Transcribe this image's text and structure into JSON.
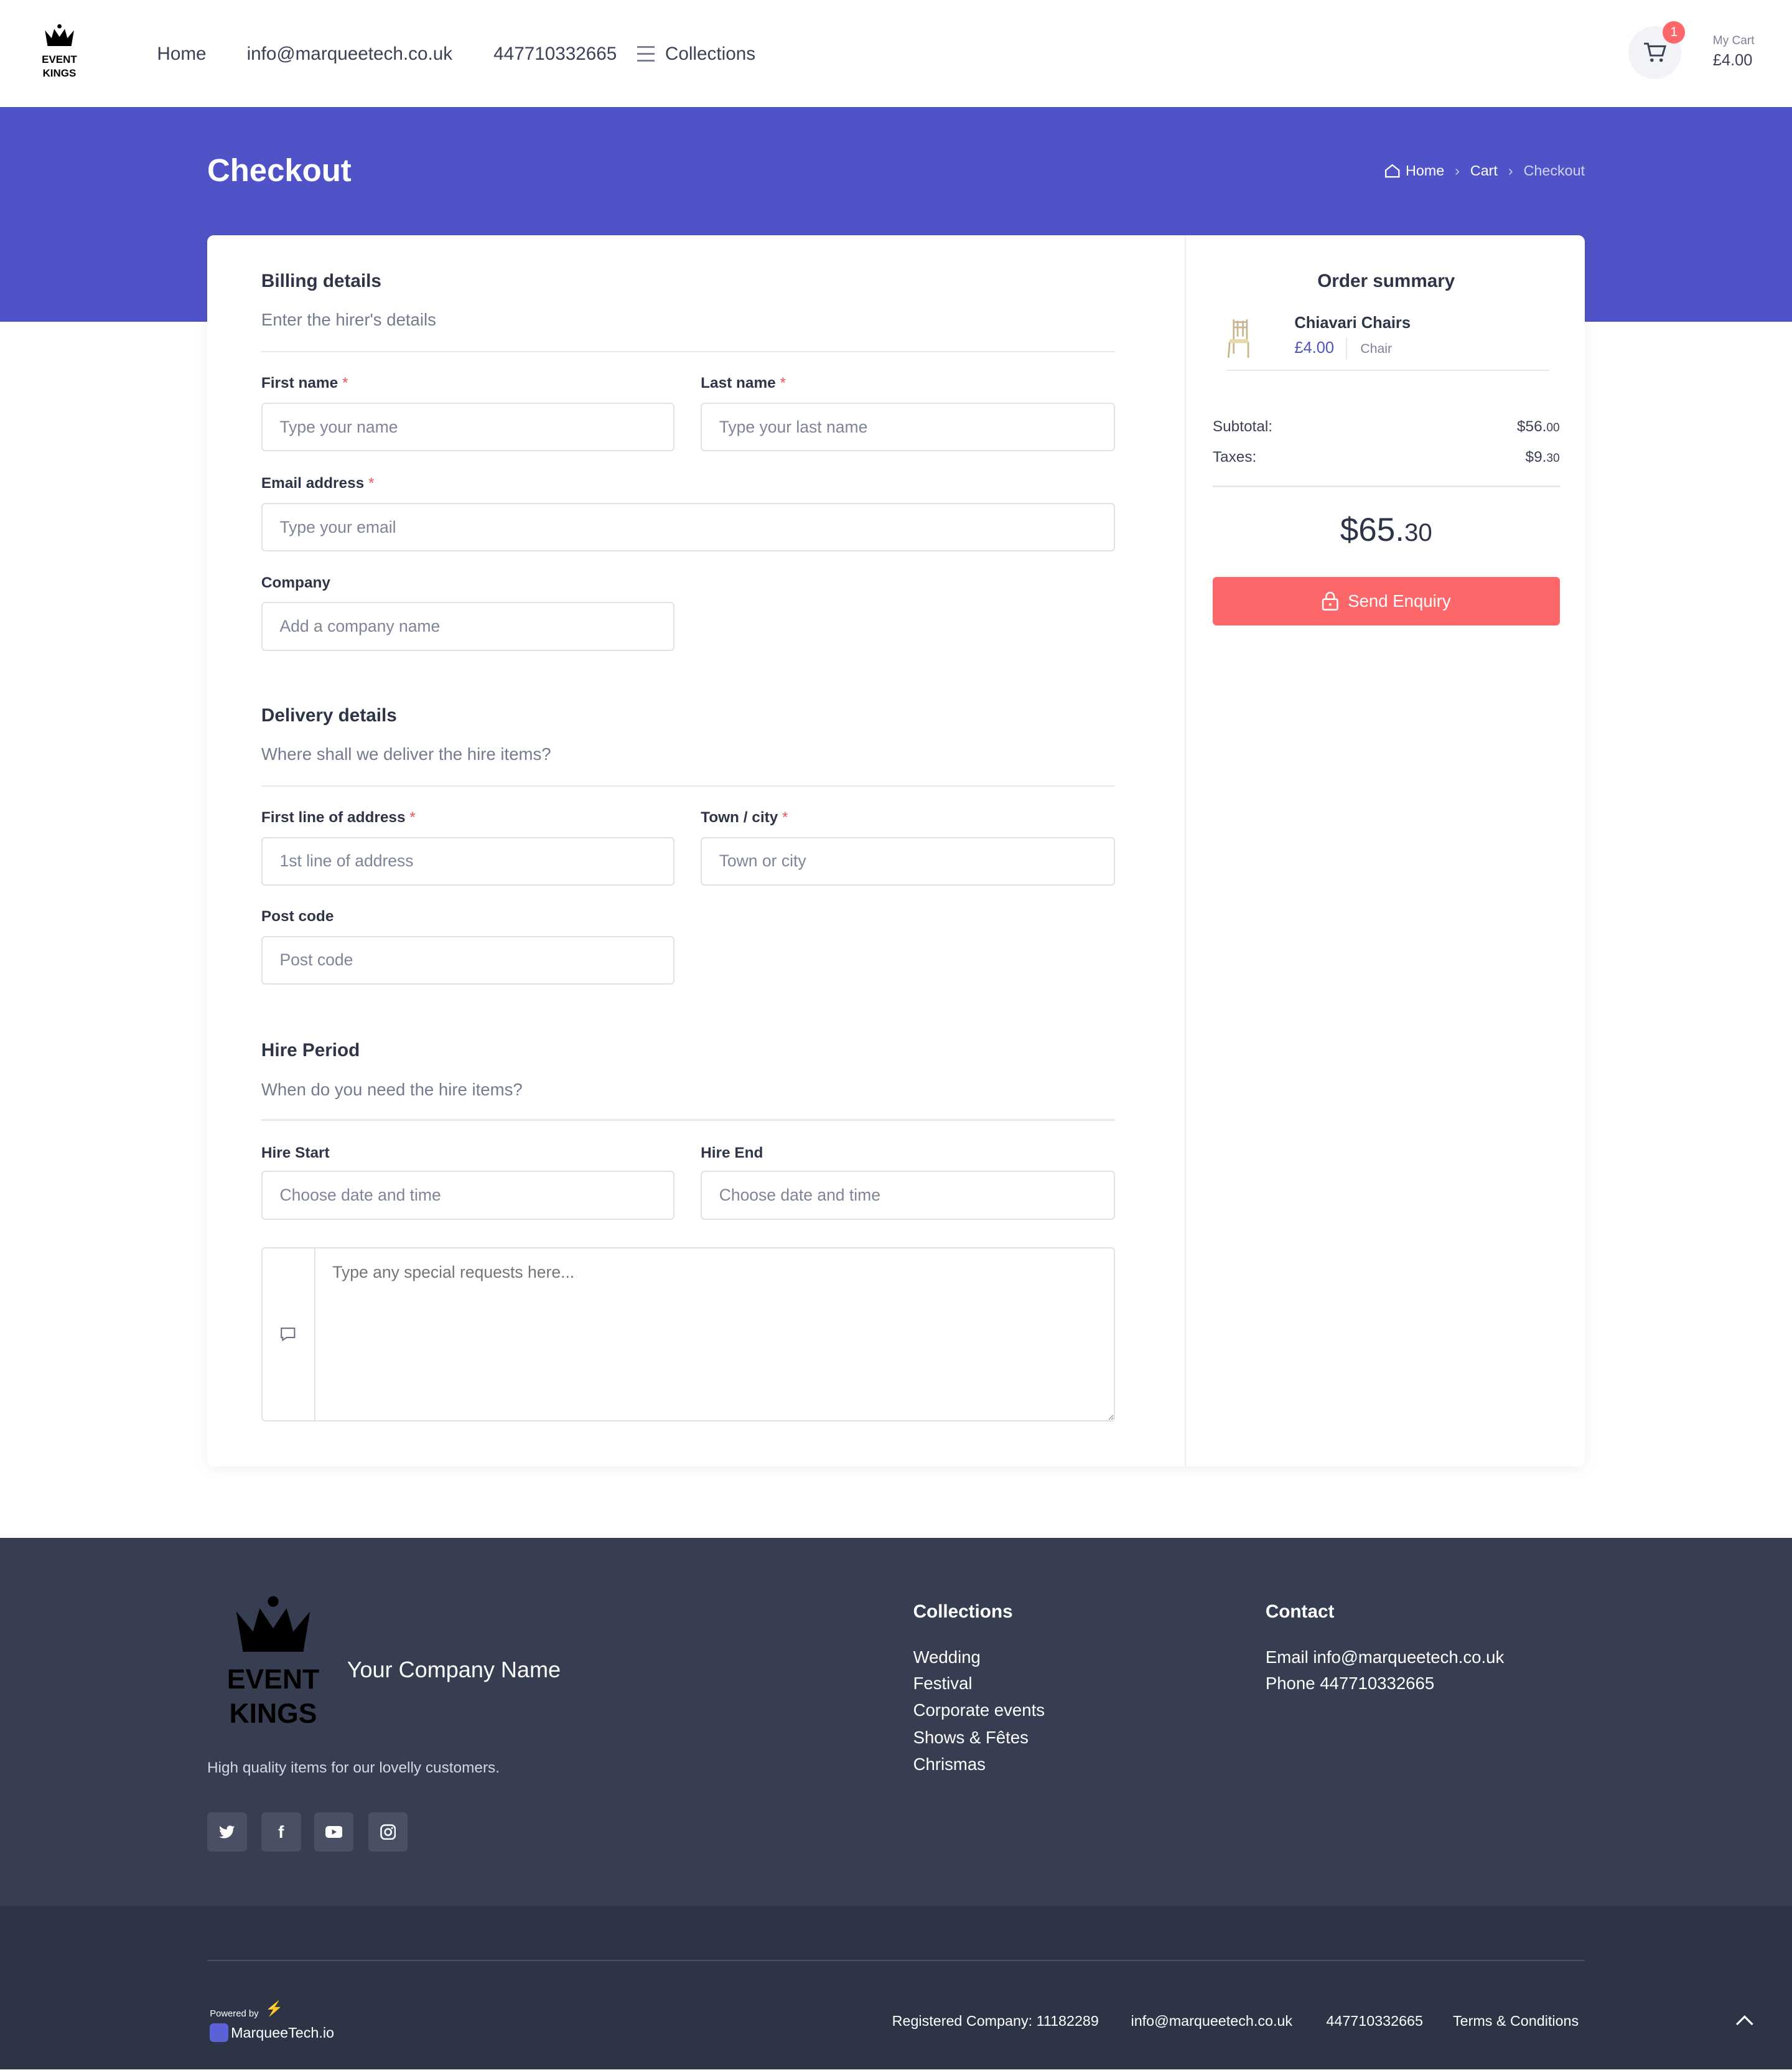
{
  "header": {
    "logo_text": [
      "EVENT",
      "KINGS"
    ],
    "nav": [
      "Home",
      "info@marqueetech.co.uk",
      "447710332665",
      "Collections"
    ],
    "cart_badge": "1",
    "cart_label": "My Cart",
    "cart_total": "£4.00"
  },
  "banner": {
    "title": "Checkout",
    "breadcrumb": [
      "Home",
      "Cart",
      "Checkout"
    ]
  },
  "billing": {
    "title": "Billing details",
    "subtitle": "Enter the hirer's details",
    "first_name": {
      "label": "First name",
      "placeholder": "Type your name"
    },
    "last_name": {
      "label": "Last name",
      "placeholder": "Type your last name"
    },
    "email": {
      "label": "Email address",
      "placeholder": "Type your email"
    },
    "company": {
      "label": "Company",
      "placeholder": "Add a company name"
    }
  },
  "delivery": {
    "title": "Delivery details",
    "subtitle": "Where shall we deliver the hire items?",
    "address": {
      "label": "First line of address",
      "placeholder": "1st line of address"
    },
    "town": {
      "label": "Town / city",
      "placeholder": "Town or city"
    },
    "postcode": {
      "label": "Post code",
      "placeholder": "Post code"
    }
  },
  "hire": {
    "title": "Hire Period",
    "subtitle": "When do you need the hire items?",
    "start": {
      "label": "Hire Start",
      "placeholder": "Choose date and time"
    },
    "end": {
      "label": "Hire End",
      "placeholder": "Choose date and time"
    },
    "requests_placeholder": "Type any special requests here..."
  },
  "required_mark": "*",
  "summary": {
    "title": "Order summary",
    "item": {
      "name": "Chiavari Chairs",
      "price": "£4.00",
      "category": "Chair"
    },
    "subtotal_label": "Subtotal:",
    "subtotal_main": "$56.",
    "subtotal_cents": "00",
    "taxes_label": "Taxes:",
    "taxes_main": "$9.",
    "taxes_cents": "30",
    "total_main": "$65.",
    "total_cents": "30",
    "button": "Send Enquiry"
  },
  "footer": {
    "company_name": "Your Company Name",
    "tagline": "High quality items for our lovelly customers.",
    "social": [
      "twitter",
      "facebook",
      "youtube",
      "instagram"
    ],
    "collections_title": "Collections",
    "collections": [
      "Wedding",
      "Festival",
      "Corporate events",
      "Shows & Fêtes",
      "Chrismas"
    ],
    "contact_title": "Contact",
    "contact": [
      "Email info@marqueetech.co.uk",
      "Phone 447710332665"
    ],
    "powered_by": "Powered by",
    "powered_brand": "MarqueeTech.io",
    "bottom_links": [
      "Registered Company: 11182289",
      "info@marqueetech.co.uk",
      "447710332665",
      "Terms & Conditions"
    ]
  },
  "colors": {
    "primary": "#4f53c7",
    "button": "#fd6769",
    "footer": "#383e52",
    "footer_bottom": "#2d3446"
  }
}
